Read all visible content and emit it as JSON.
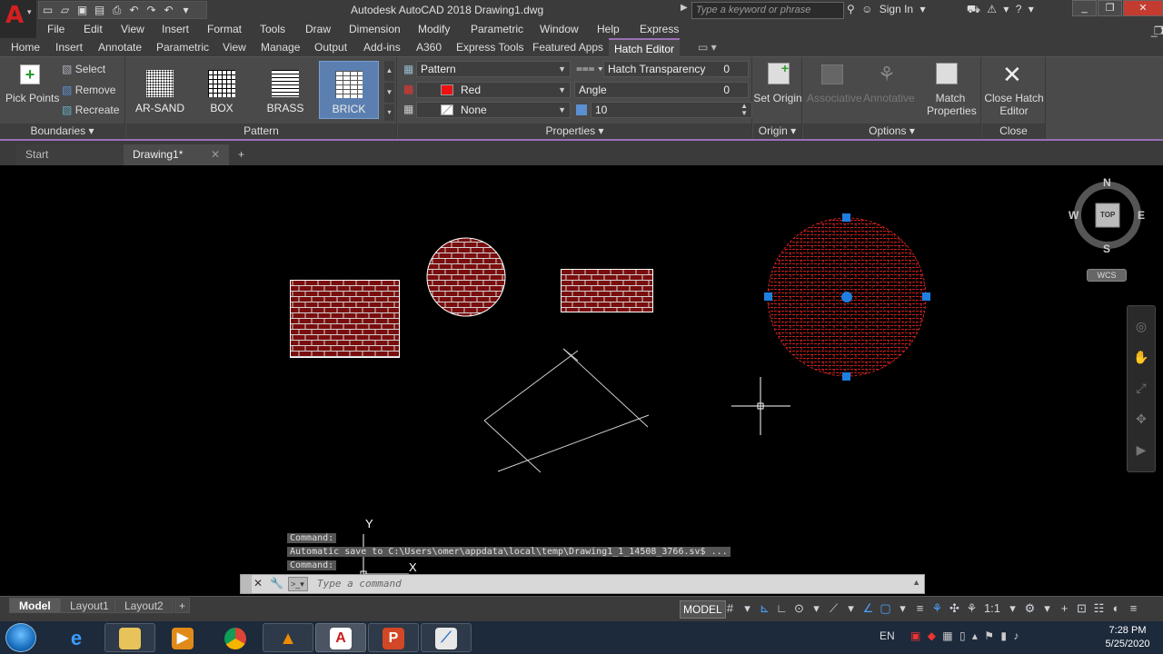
{
  "titlebar": {
    "title": "Autodesk AutoCAD 2018   Drawing1.dwg",
    "search_placeholder": "Type a keyword or phrase",
    "sign_in": "Sign In"
  },
  "menu": [
    "File",
    "Edit",
    "View",
    "Insert",
    "Format",
    "Tools",
    "Draw",
    "Dimension",
    "Modify",
    "Parametric",
    "Window",
    "Help",
    "Express"
  ],
  "ribbon_tabs": [
    "Home",
    "Insert",
    "Annotate",
    "Parametric",
    "View",
    "Manage",
    "Output",
    "Add-ins",
    "A360",
    "Express Tools",
    "Featured Apps",
    "Hatch Editor"
  ],
  "active_ribbon_tab": "Hatch Editor",
  "boundaries": {
    "title": "Boundaries",
    "pick_points": "Pick Points",
    "select": "Select",
    "remove": "Remove",
    "recreate": "Recreate"
  },
  "pattern": {
    "title": "Pattern",
    "items": [
      "AR-SAND",
      "BOX",
      "BRASS",
      "BRICK"
    ],
    "selected": "BRICK"
  },
  "properties": {
    "title": "Properties",
    "type": "Pattern",
    "color": "Red",
    "background": "None",
    "transparency_label": "Hatch Transparency",
    "transparency_value": "0",
    "angle_label": "Angle",
    "angle_value": "0",
    "scale_value": "10"
  },
  "origin": {
    "title": "Origin",
    "set_origin": "Set Origin"
  },
  "options": {
    "title": "Options",
    "associative": "Associative",
    "annotative": "Annotative",
    "match_properties": "Match Properties"
  },
  "close": {
    "title": "Close",
    "close_label": "Close Hatch Editor"
  },
  "doc_tabs": {
    "start": "Start",
    "drawing": "Drawing1*"
  },
  "viewcube": {
    "n": "N",
    "s": "S",
    "e": "E",
    "w": "W",
    "top": "TOP",
    "wcs": "WCS"
  },
  "command_history": [
    "Command:",
    "Automatic save to C:\\Users\\omer\\appdata\\local\\temp\\Drawing1_1_14508_3766.sv$ ...",
    "Command:"
  ],
  "command_placeholder": "Type a command",
  "ucs": {
    "y": "Y",
    "x": "X"
  },
  "layout_tabs": [
    "Model",
    "Layout1",
    "Layout2"
  ],
  "status": {
    "model": "MODEL",
    "scale": "1:1"
  },
  "taskbar": {
    "lang": "EN",
    "time": "7:28 PM",
    "date": "5/25/2020"
  },
  "colors": {
    "hatch": "#cc1f1f",
    "grip": "#1e7fe0",
    "accent": "#9b6fb5",
    "close_btn": "#c43b30"
  }
}
